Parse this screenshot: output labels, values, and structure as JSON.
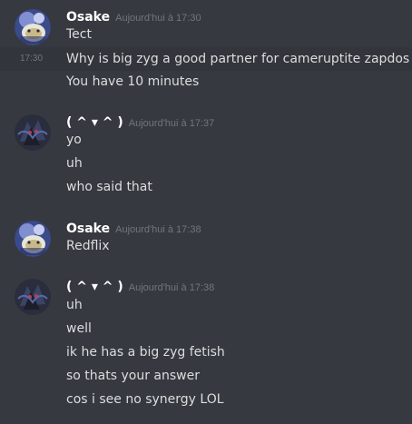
{
  "theme": {
    "background": "#36393f",
    "hover_background": "#32353b",
    "username_color": "#ffffff",
    "text_color": "#dcddde",
    "timestamp_color": "#72767d"
  },
  "messages": [
    {
      "author": "Osake",
      "avatar_icon": "osake-avatar-icon",
      "timestamp": "Aujourd'hui à 17:30",
      "lines": [
        "Tect",
        "Why is big zyg a good partner for cameruptite zapdos",
        "You have 10 minutes"
      ],
      "hover_line_timestamp": "17:30"
    },
    {
      "author": "( ^ ▾ ^ )",
      "avatar_icon": "dark-creature-avatar-icon",
      "timestamp": "Aujourd'hui à 17:37",
      "lines": [
        "yo",
        "uh",
        "who said that"
      ]
    },
    {
      "author": "Osake",
      "avatar_icon": "osake-avatar-icon",
      "timestamp": "Aujourd'hui à 17:38",
      "lines": [
        "Redflix"
      ]
    },
    {
      "author": "( ^ ▾ ^ )",
      "avatar_icon": "dark-creature-avatar-icon",
      "timestamp": "Aujourd'hui à 17:38",
      "lines": [
        "uh",
        "well",
        "ik he has a big zyg fetish",
        "so thats your answer",
        "cos i see no synergy LOL"
      ]
    }
  ]
}
